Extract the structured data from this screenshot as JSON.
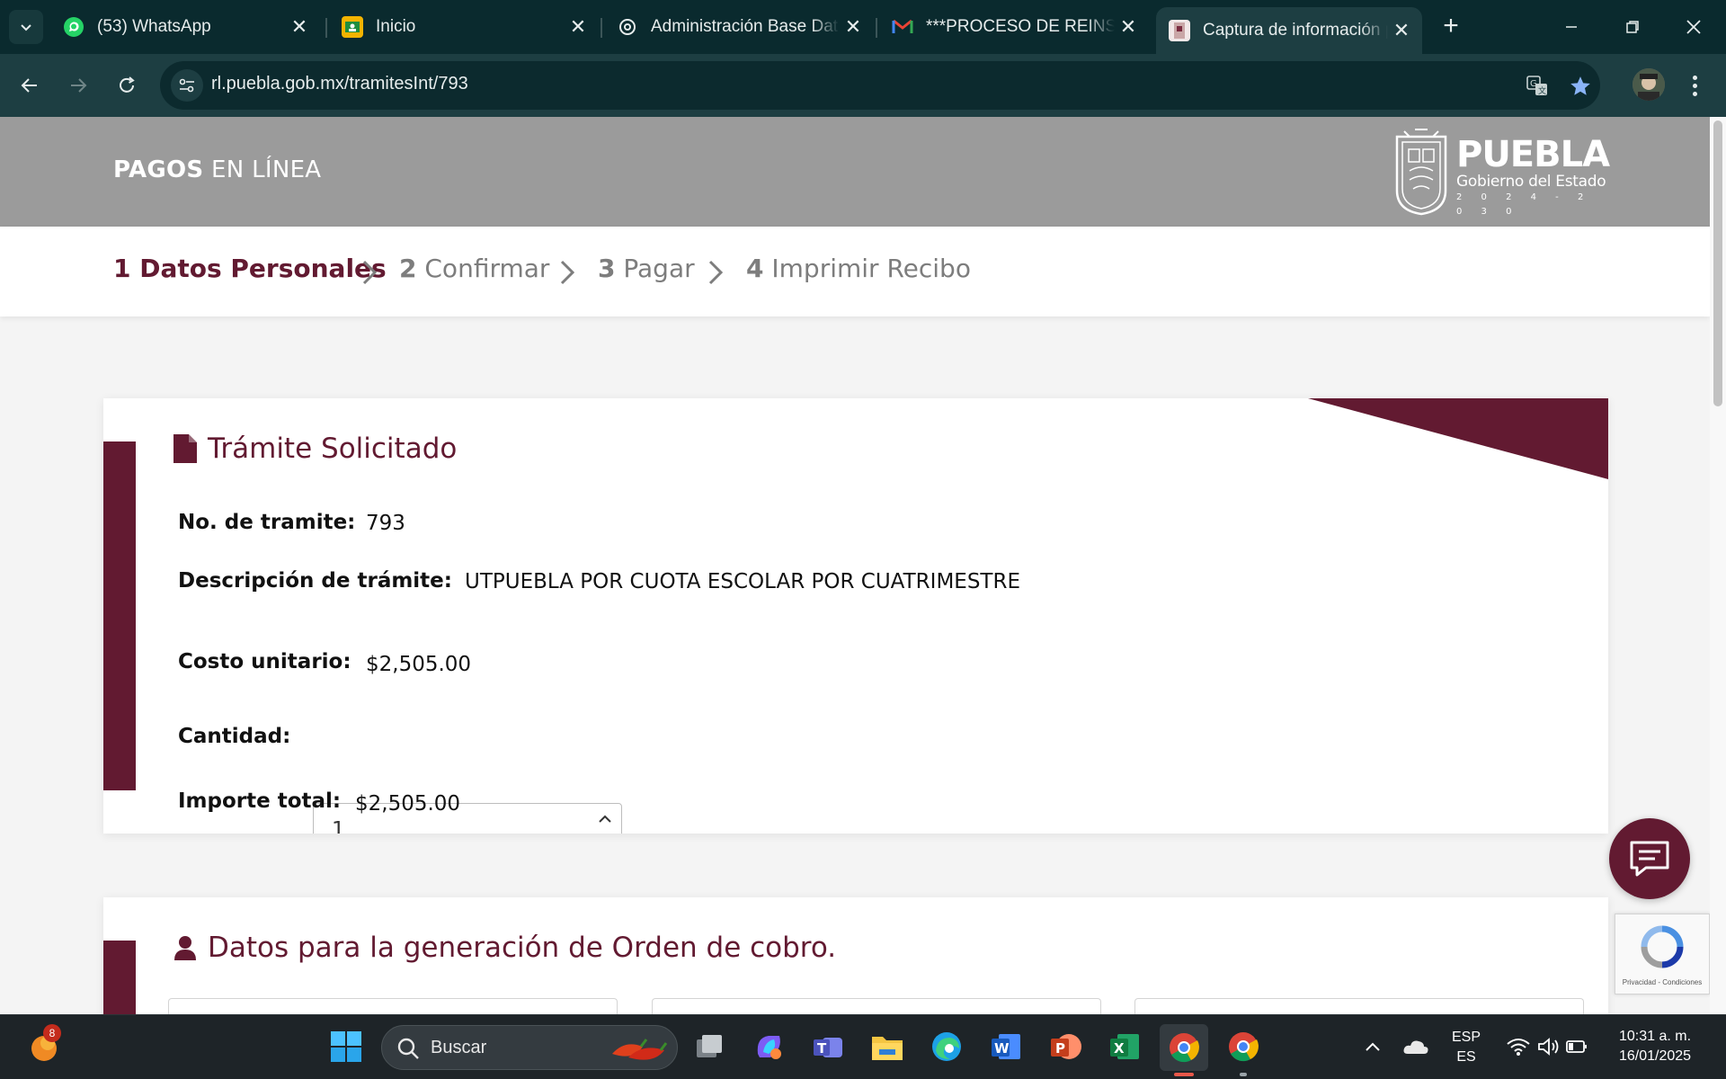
{
  "browser": {
    "tabs": [
      {
        "title": "(53) WhatsApp",
        "icon": "whatsapp-icon",
        "active": false
      },
      {
        "title": "Inicio",
        "icon": "classroom-icon",
        "active": false
      },
      {
        "title": "Administración Base Dat",
        "icon": "openai-icon",
        "active": false
      },
      {
        "title": "***PROCESO DE REINSCR",
        "icon": "gmail-icon",
        "active": false
      },
      {
        "title": "Captura de información p",
        "icon": "page-icon",
        "active": true
      }
    ],
    "url": "rl.puebla.gob.mx/tramitesInt/793"
  },
  "header": {
    "title_bold": "PAGOS",
    "title_light": " EN LÍNEA",
    "logo_word": "PUEBLA",
    "logo_sub": "Gobierno del Estado",
    "logo_years": "2024-2030"
  },
  "steps": [
    {
      "num": "1",
      "label": " Datos Personales",
      "active": true
    },
    {
      "num": "2",
      "label": " Confirmar",
      "active": false
    },
    {
      "num": "3",
      "label": " Pagar",
      "active": false
    },
    {
      "num": "4",
      "label": " Imprimir Recibo",
      "active": false
    }
  ],
  "tramite": {
    "heading": "Trámite Solicitado",
    "no_label": "No. de tramite:",
    "no_value": "793",
    "desc_label": "Descripción de trámite:",
    "desc_value": "UTPUEBLA POR CUOTA ESCOLAR POR CUATRIMESTRE",
    "cost_label": "Costo unitario:",
    "cost_value": "$2,505.00",
    "qty_label": "Cantidad:",
    "qty_value": "1",
    "total_label": "Importe total:",
    "total_value": "$2,505.00"
  },
  "orden": {
    "heading": "Datos para la generación de Orden de cobro."
  },
  "recaptcha": {
    "text": "Privacidad - Condiciones"
  },
  "taskbar": {
    "search_placeholder": "Buscar",
    "lang_top": "ESP",
    "lang_bottom": "ES",
    "time": "10:31 a. m.",
    "date": "16/01/2025",
    "notif_count": "8"
  },
  "colors": {
    "brand": "#621a31",
    "header_gray": "#9b9b9b",
    "chrome": "#1d3e42"
  }
}
